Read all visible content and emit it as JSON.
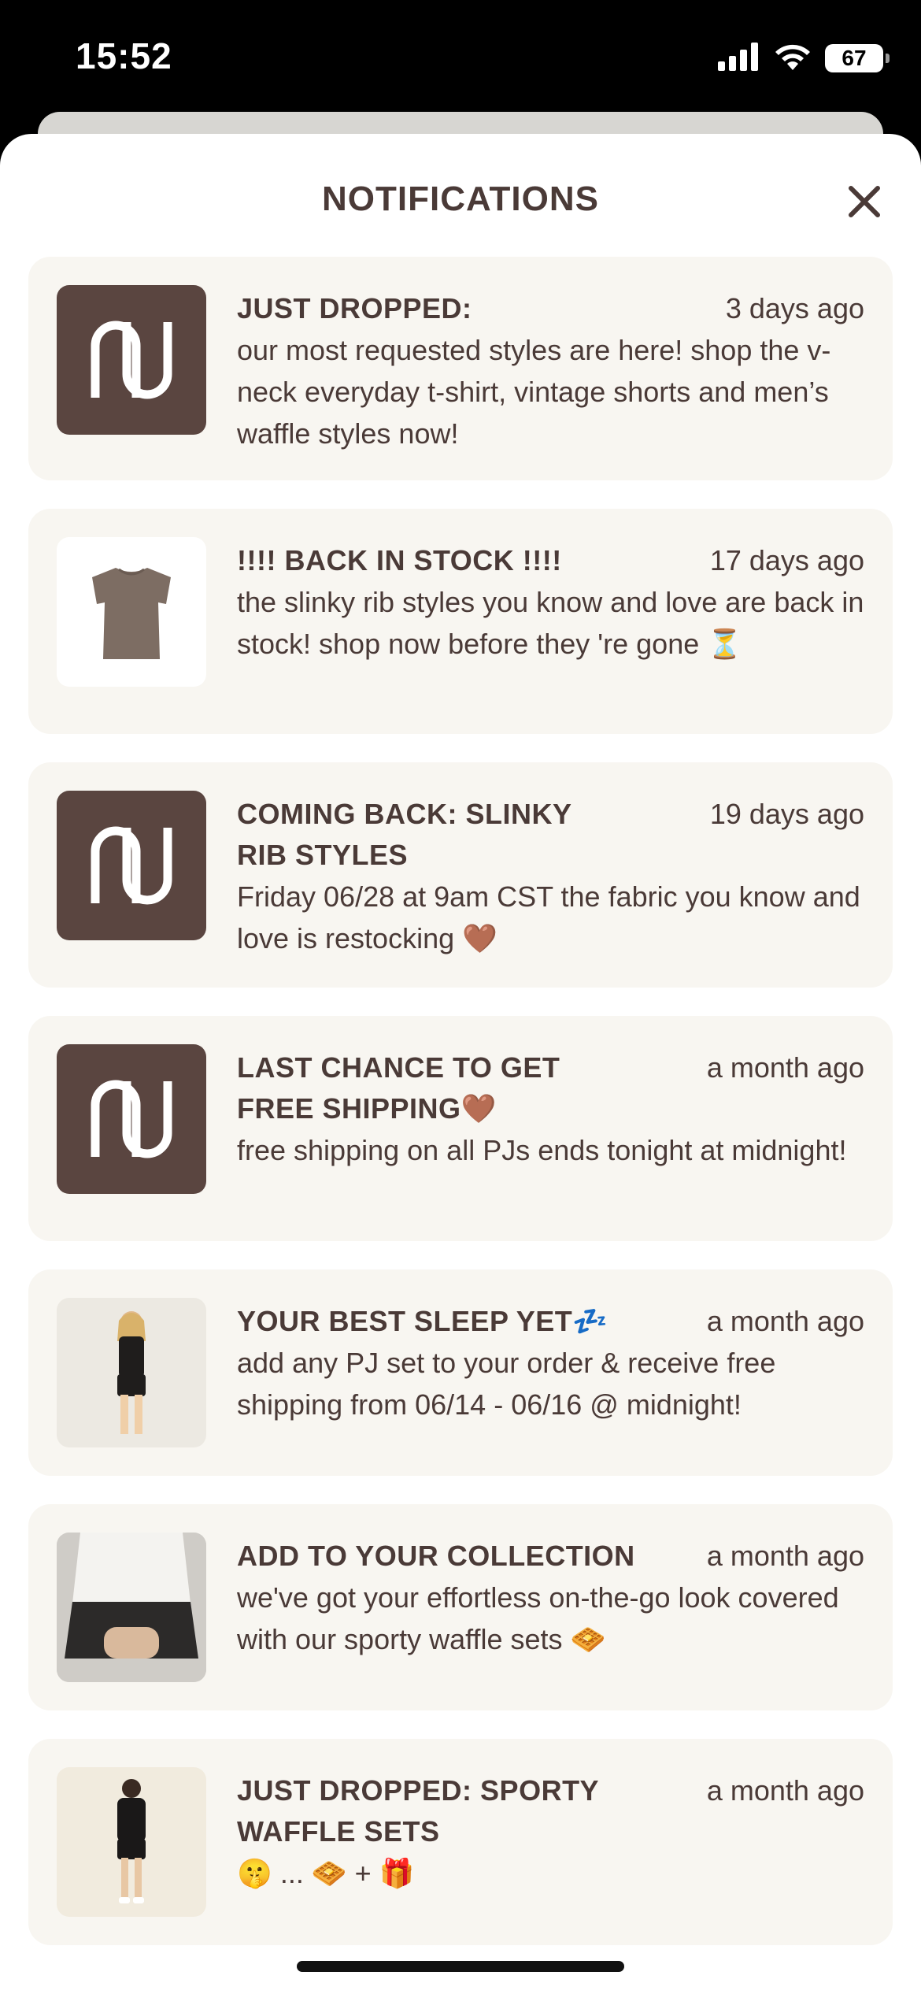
{
  "status_bar": {
    "time": "15:52",
    "battery": "67",
    "icons": [
      "cellular-signal-icon",
      "wifi-icon",
      "battery-icon"
    ]
  },
  "header": {
    "title": "NOTIFICATIONS",
    "close_icon": "close-icon"
  },
  "colors": {
    "accent": "#4a3a37",
    "card_bg": "#f8f6f1",
    "logo_bg": "#5a4540"
  },
  "notifications": [
    {
      "title": "JUST DROPPED:",
      "time": "3 days ago",
      "body": "our most requested styles are here! shop the v-neck everyday t-shirt, vintage shorts and men’s waffle styles now!",
      "thumb": "brand-logo"
    },
    {
      "title": "!!!! BACK IN STOCK !!!!",
      "time": "17 days ago",
      "body": "the slinky rib styles you know and love are back in stock! shop now before they 're gone ⏳",
      "thumb": "tshirt-image"
    },
    {
      "title": "COMING BACK: SLINKY RIB STYLES",
      "time": "19 days ago",
      "body": "Friday 06/28 at 9am CST the fabric you know and love is restocking 🤎",
      "thumb": "brand-logo"
    },
    {
      "title": "LAST CHANCE TO GET FREE SHIPPING🤎",
      "time": "a month ago",
      "body": "free shipping on all PJs ends tonight at midnight!",
      "thumb": "brand-logo"
    },
    {
      "title": "YOUR BEST SLEEP YET💤",
      "time": "a month ago",
      "body": "add any PJ set to your order & receive free shipping from 06/14 - 06/16 @ midnight!",
      "thumb": "model-pj-image"
    },
    {
      "title": "ADD TO YOUR COLLECTION",
      "time": "a month ago",
      "body": "we've got your effortless on-the-go look covered with our sporty waffle sets 🧇",
      "thumb": "model-waffle-image"
    },
    {
      "title": "JUST DROPPED: SPORTY WAFFLE SETS",
      "time": "a month ago",
      "body": "🤫 ... 🧇 + 🎁",
      "thumb": "model-sporty-image"
    }
  ]
}
